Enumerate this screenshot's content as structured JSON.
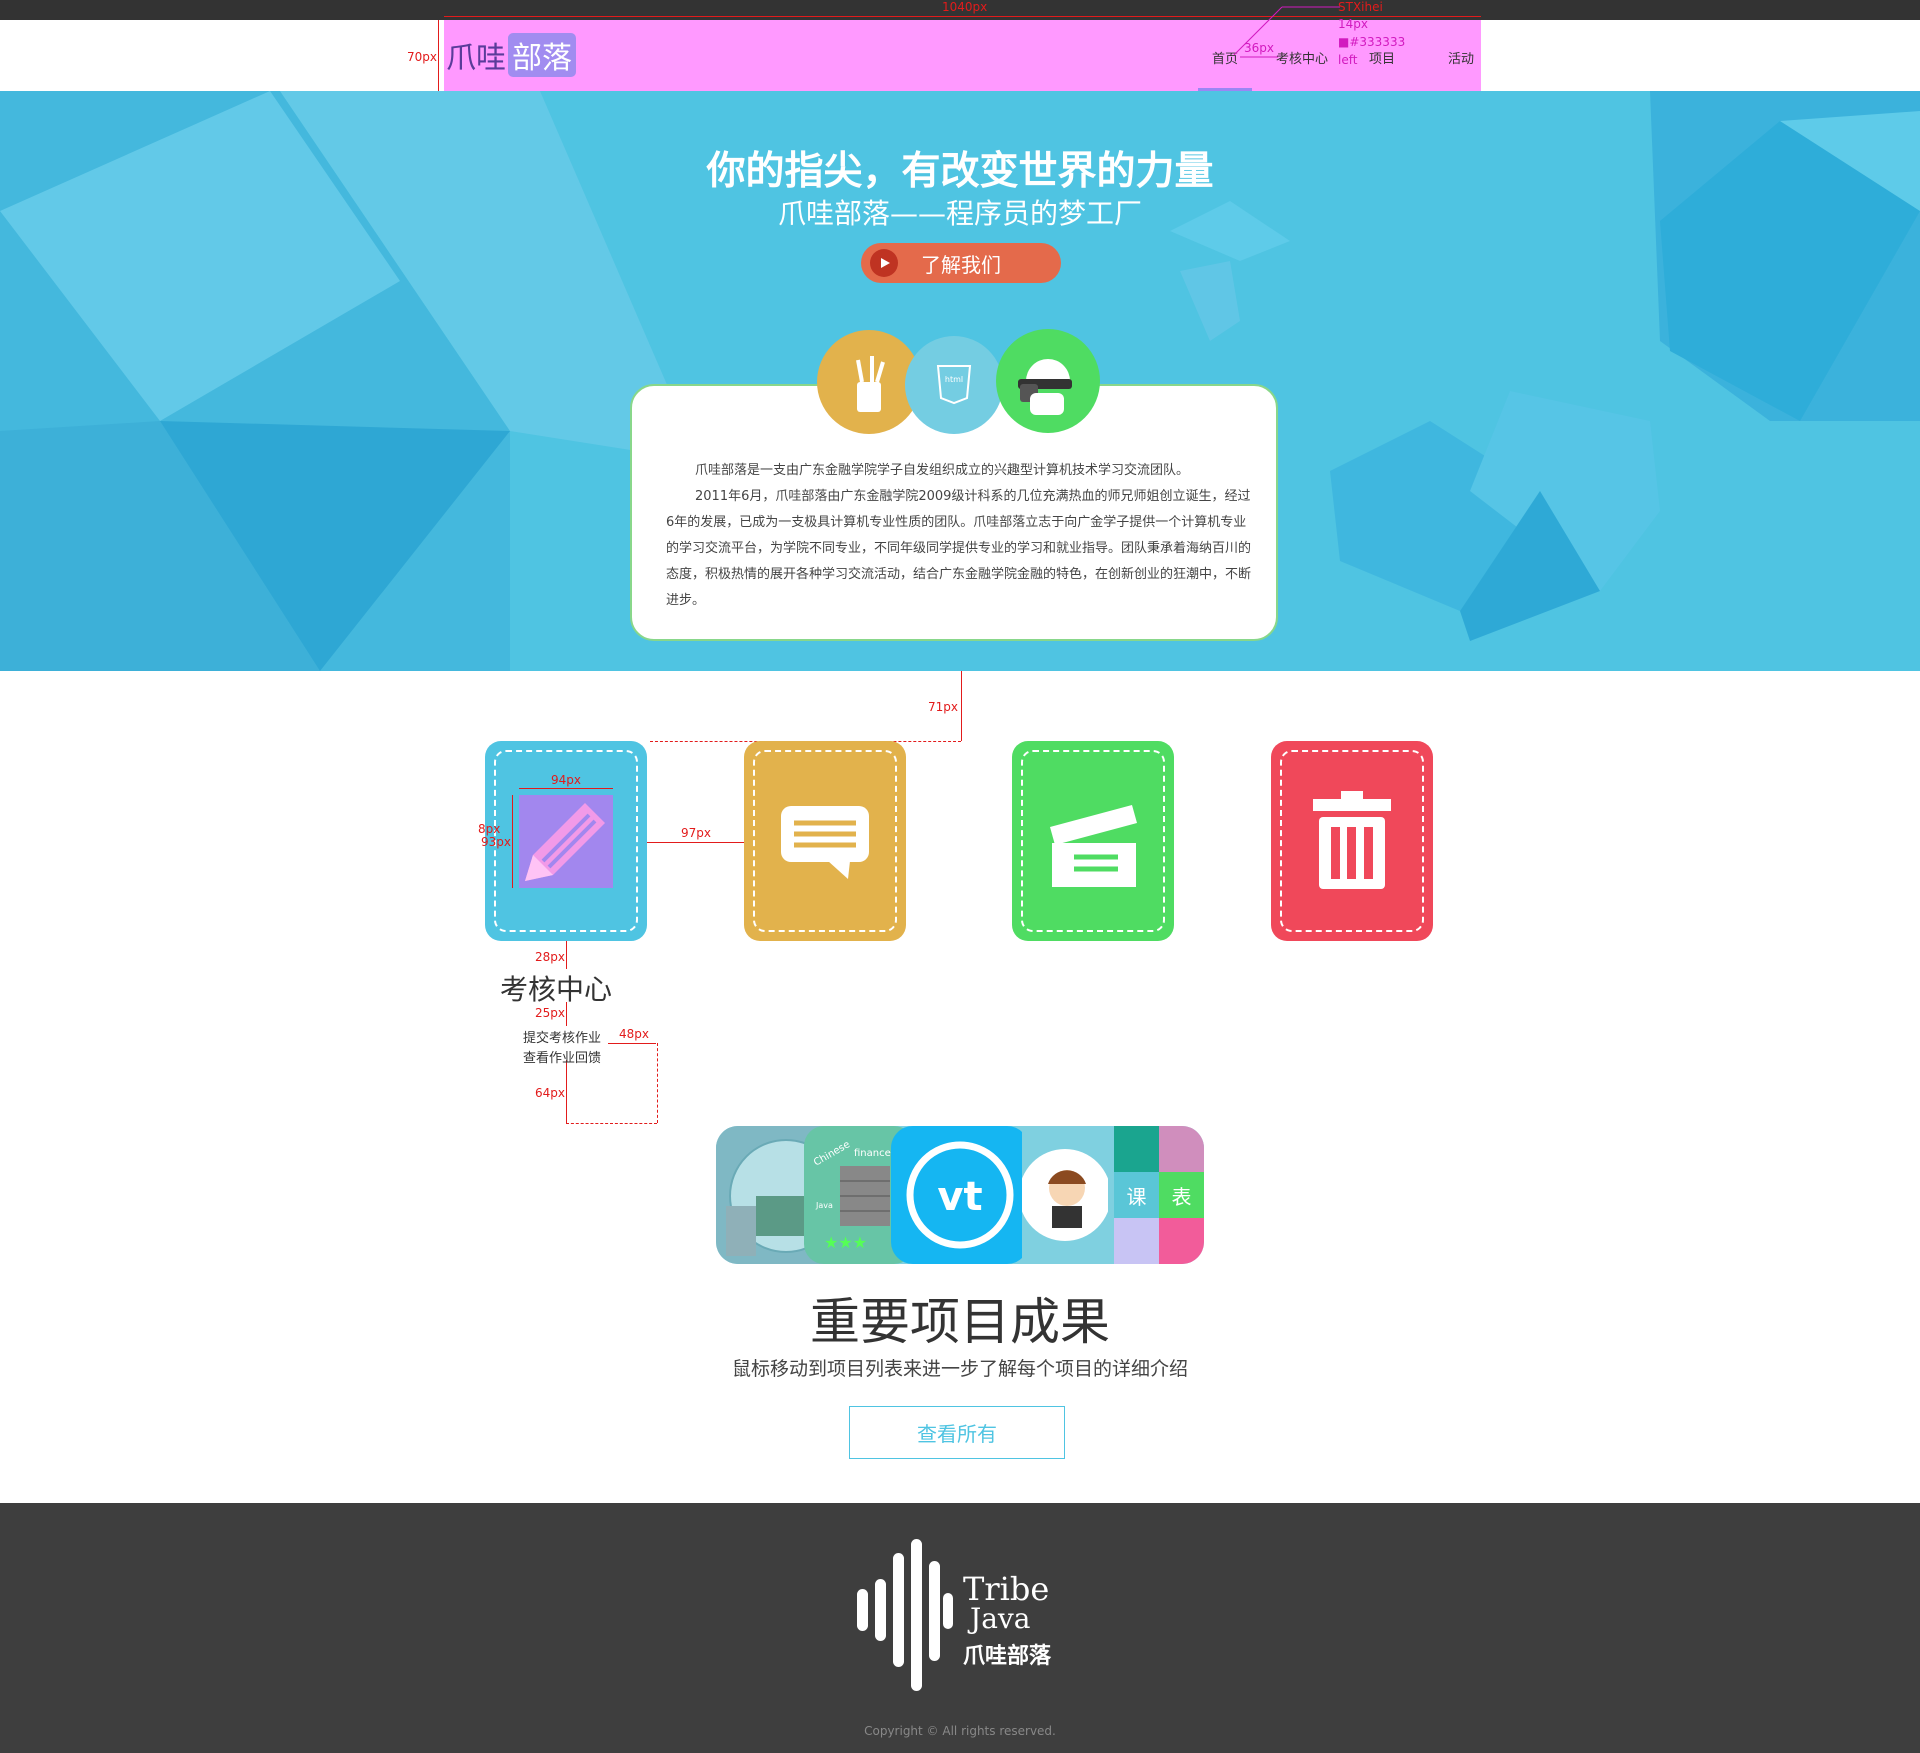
{
  "header": {
    "logo_part1": "爪哇",
    "logo_part2": "部落",
    "nav": [
      {
        "label": "首页"
      },
      {
        "label": "考核中心"
      },
      {
        "label": "项目"
      },
      {
        "label": "活动"
      }
    ]
  },
  "annotations": {
    "width_1040": "1040px",
    "height_70": "70px",
    "font": "STXihei",
    "size_14": "14px",
    "color": "#333333",
    "align": "left",
    "gap_36": "36px",
    "gap_71": "71px",
    "w_94": "94px",
    "v_8": "8px",
    "v_93": "93px",
    "gap_97": "97px",
    "gap_28": "28px",
    "gap_25": "25px",
    "gap_48": "48px",
    "gap_64": "64px"
  },
  "hero": {
    "title": "你的指尖，有改变世界的力量",
    "subtitle": "爪哇部落——程序员的梦工厂",
    "button": "了解我们",
    "html5_badge": "html",
    "paragraphs": [
      "爪哇部落是一支由广东金融学院学子自发组织成立的兴趣型计算机技术学习交流团队。",
      "2011年6月，爪哇部落由广东金融学院2009级计科系的几位充满热血的师兄师姐创立诞生，经过6年的发展，已成为一支极具计算机专业性质的团队。爪哇部落立志于向广金学子提供一个计算机专业的学习交流平台，为学院不同专业，不同年级同学提供专业的学习和就业指导。团队秉承着海纳百川的态度，积极热情的展开各种学习交流活动，结合广东金融学院金融的特色，在创新创业的狂潮中，不断进步。"
    ]
  },
  "features": {
    "tiles": [
      {
        "name": "pencil",
        "color": "#4fc4e2"
      },
      {
        "name": "chat",
        "color": "#e2b24c"
      },
      {
        "name": "clapper",
        "color": "#4fdc62"
      },
      {
        "name": "trash",
        "color": "#f0485a"
      }
    ],
    "title": "考核中心",
    "items": [
      "提交考核作业",
      "查看作业回馈"
    ]
  },
  "projects": {
    "collage_texts": {
      "kebiao1": "课",
      "kebiao2": "表",
      "vt": "vt",
      "java": "Java",
      "chinese": "Chinese",
      "finance": "finance"
    },
    "title": "重要项目成果",
    "subtitle": "鼠标移动到项目列表来进一步了解每个项目的详细介绍",
    "button": "查看所有"
  },
  "footer": {
    "logo_line1": "Tribe",
    "logo_line2": "Java",
    "logo_line3": "爪哇部落",
    "copyright": "Copyright © All rights reserved."
  }
}
